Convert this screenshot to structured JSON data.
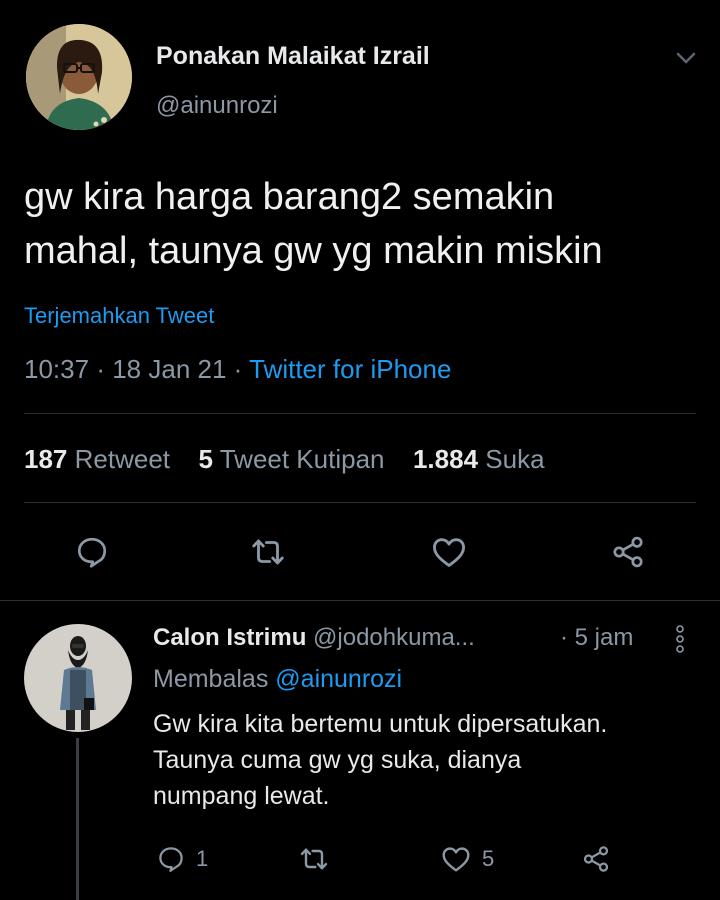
{
  "tweet": {
    "author_name": "Ponakan Malaikat Izrail",
    "author_handle": "@ainunrozi",
    "text_line1": "gw kira harga barang2 semakin",
    "text_line2": "mahal, taunya gw yg makin miskin",
    "translate_label": "Terjemahkan Tweet",
    "time": "10:37",
    "sep1": "·",
    "date": "18 Jan 21",
    "sep2": "·",
    "source": "Twitter for iPhone",
    "stats": {
      "retweets_count": "187",
      "retweets_label": "Retweet",
      "quotes_count": "5",
      "quotes_label": "Tweet Kutipan",
      "likes_count": "1.884",
      "likes_label": "Suka"
    }
  },
  "reply": {
    "author_name": "Calon Istrimu",
    "author_handle": "@jodohkuma...",
    "time": "· 5 jam",
    "replying_prefix": "Membalas",
    "replying_to": "@ainunrozi",
    "text_line1": "Gw kira kita bertemu untuk dipersatukan.",
    "text_line2": "Taunya cuma gw yg suka, dianya",
    "text_line3": "numpang lewat.",
    "reply_count": "1",
    "like_count": "5"
  },
  "icons": {
    "reply": "reply-icon",
    "retweet": "retweet-icon",
    "like": "heart-icon",
    "share": "share-icon",
    "chevron": "chevron-down-icon",
    "more": "more-vertical-icon"
  },
  "colors": {
    "background": "#000000",
    "text": "#e7e9ea",
    "muted": "#8b98a5",
    "link": "#1d9bf0",
    "divider": "#2a2f33"
  }
}
